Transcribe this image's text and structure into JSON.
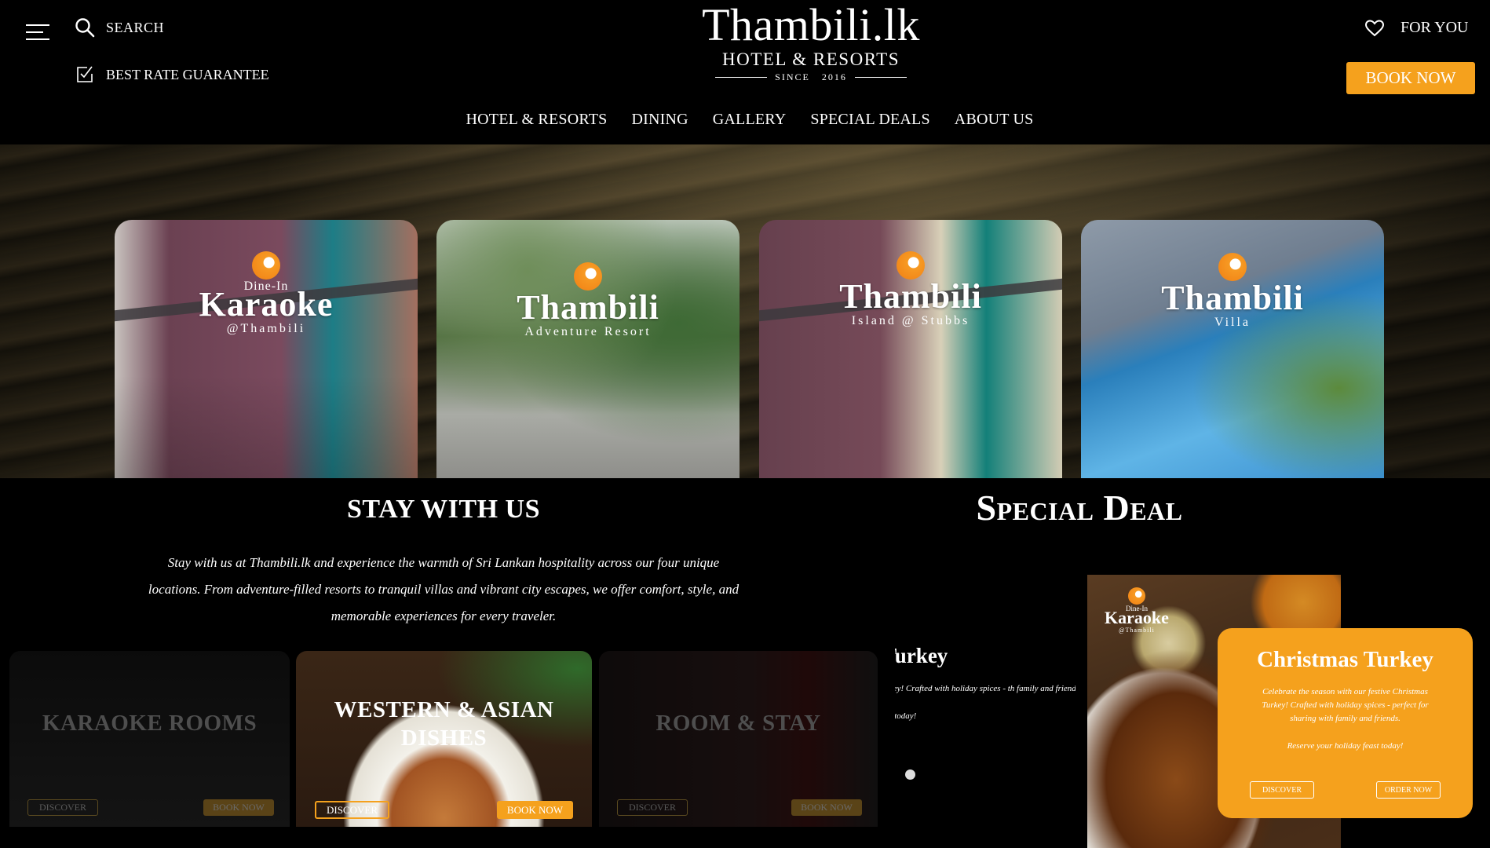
{
  "header": {
    "search_label": "SEARCH",
    "best_rate_label": "BEST RATE GUARANTEE",
    "logo": {
      "title": "Thambili.lk",
      "subtitle": "HOTEL & RESORTS",
      "since": "SINCE   2016"
    },
    "for_you_label": "FOR YOU",
    "book_now_label": "BOOK NOW",
    "accent_color": "#f5a11d"
  },
  "nav": {
    "items": [
      {
        "label": "HOTEL & RESORTS"
      },
      {
        "label": "DINING"
      },
      {
        "label": "GALLERY"
      },
      {
        "label": "SPECIAL DEALS"
      },
      {
        "label": "ABOUT US"
      }
    ]
  },
  "hero": {
    "cards": [
      {
        "pre": "Dine-In",
        "title": "Karaoke",
        "sub": "@Thambili"
      },
      {
        "title": "Thambili",
        "sub": "Adventure Resort"
      },
      {
        "title": "Thambili",
        "sub": "Island @ Stubbs"
      },
      {
        "title": "Thambili",
        "sub": "Villa"
      }
    ]
  },
  "stay": {
    "title": "STAY WITH US",
    "text": "Stay with us at Thambili.lk and experience the warmth of Sri Lankan hospitality across our four unique locations. From adventure-filled resorts to tranquil villas and vibrant city escapes, we offer comfort, style, and memorable experiences for every traveler.",
    "tiles": [
      {
        "title": "KARAOKE ROOMS",
        "discover_label": "DISCOVER",
        "book_label": "BOOK NOW"
      },
      {
        "title": "WESTERN & ASIAN DISHES",
        "discover_label": "DISCOVER",
        "book_label": "BOOK NOW"
      },
      {
        "title": "ROOM & STAY",
        "discover_label": "DISCOVER",
        "book_label": "BOOK NOW"
      }
    ]
  },
  "deal": {
    "title": "Special Deal",
    "prev": {
      "title": "as Turkey",
      "text": "tmas Turkey! Crafted with holiday spices - th family and friends.",
      "cta": "iday feast today!"
    },
    "image_logo": {
      "pre": "Dine-In",
      "name": "Karaoke",
      "sub": "@Thambili"
    },
    "card": {
      "title": "Christmas Turkey",
      "text": "Celebrate the season with our festive Christmas Turkey! Crafted with holiday spices - perfect for sharing with family and friends.",
      "cta": "Reserve your holiday feast today!",
      "discover_label": "DISCOVER",
      "order_label": "ORDER NOW"
    }
  }
}
